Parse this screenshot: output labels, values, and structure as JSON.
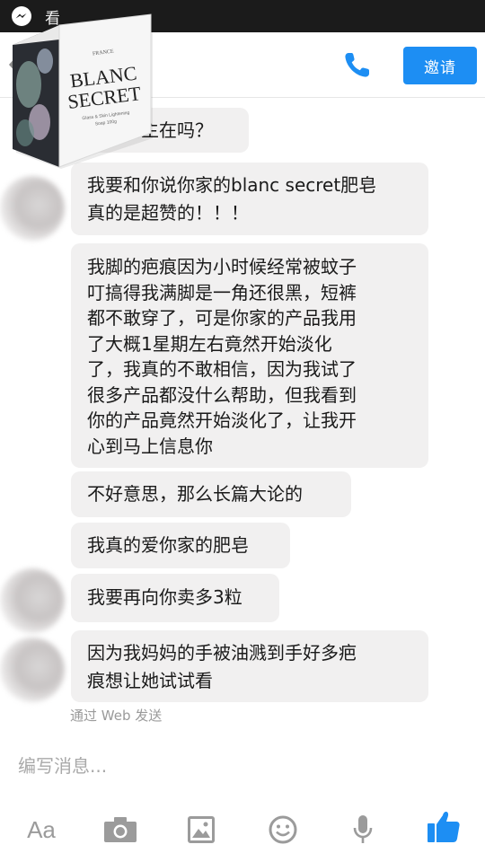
{
  "status_bar": {
    "text": "看"
  },
  "header": {
    "invite_label": "邀请"
  },
  "product": {
    "brand_top": "FRANCE",
    "brand_line1": "BLANC",
    "brand_line2": "SECRET",
    "small_line1": "Glass & Skin Lightening",
    "small_line2": "Soap 100g"
  },
  "messages": [
    {
      "lines": [
        "请问店主在吗？"
      ]
    },
    {
      "lines": [
        "我要和你说你家的blanc secret肥皂",
        "真的是超赞的！！！"
      ]
    },
    {
      "lines": [
        "我脚的疤痕因为小时候经常被蚊子",
        "叮搞得我满脚是一角还很黑，短裤",
        "都不敢穿了，可是你家的产品我用",
        "了大概1星期左右竟然开始淡化",
        "了，我真的不敢相信，因为我试了",
        "很多产品都没什么帮助，但我看到",
        "你的产品竟然开始淡化了，让我开",
        "心到马上信息你"
      ]
    },
    {
      "lines": [
        "不好意思，那么长篇大论的"
      ]
    },
    {
      "lines": [
        "我真的爱你家的肥皂"
      ]
    },
    {
      "lines": [
        "我要再向你卖多3粒"
      ]
    },
    {
      "lines": [
        "因为我妈妈的手被油溅到手好多疤",
        "痕想让她试试看"
      ]
    }
  ],
  "via_web": "通过 Web 发送",
  "composer": {
    "placeholder": "编写消息..."
  },
  "toolbar": {
    "text_button_label": "Aa"
  },
  "colors": {
    "accent": "#1d8ef3",
    "bubble": "#f1f0f0",
    "icon_gray": "#9b9b9b"
  }
}
